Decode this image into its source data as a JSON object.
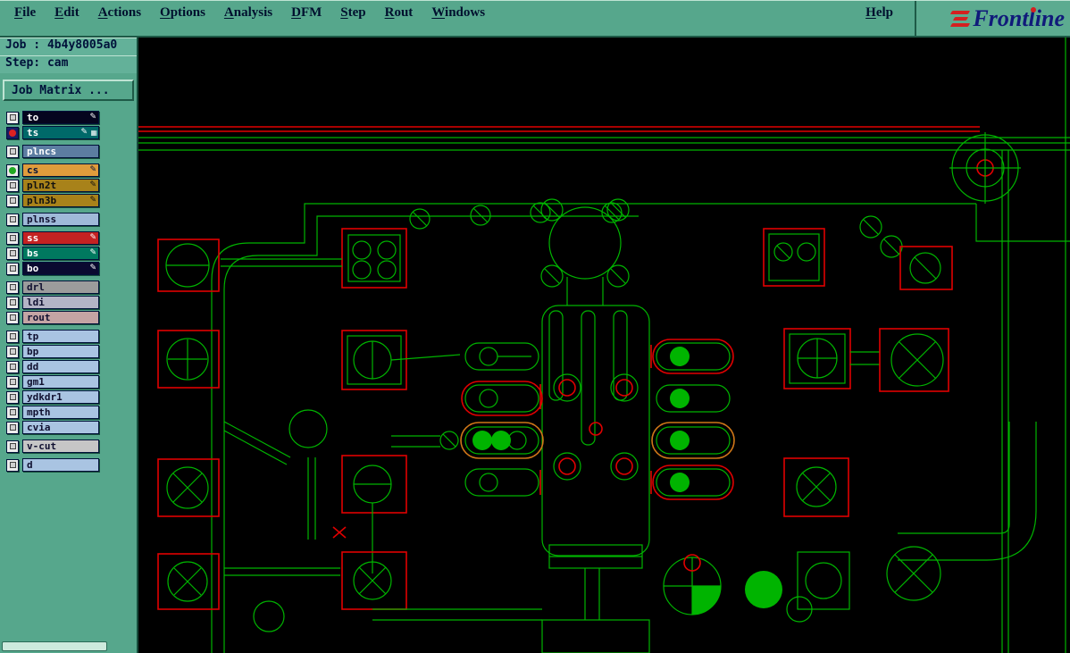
{
  "menu": {
    "items": [
      "File",
      "Edit",
      "Actions",
      "Options",
      "Analysis",
      "DFM",
      "Step",
      "Rout",
      "Windows"
    ],
    "help": "Help"
  },
  "brand": {
    "name": "Frontline"
  },
  "sidebar": {
    "job": "Job : 4b4y8005a0",
    "step": "Step: cam",
    "job_matrix": "Job Matrix ...",
    "layers": [
      {
        "name": "to",
        "bg": "#05051e",
        "fg": "#ffffff",
        "indicator": "square",
        "pen": true,
        "extra": false,
        "group": 0
      },
      {
        "name": "ts",
        "bg": "#006969",
        "fg": "#ffffff",
        "indicator": "red-dot",
        "pen": true,
        "extra": true,
        "group": 0
      },
      {
        "name": "plncs",
        "bg": "#5c7da1",
        "fg": "#ffffff",
        "indicator": "square",
        "pen": false,
        "extra": false,
        "group": 1
      },
      {
        "name": "cs",
        "bg": "#e09c3c",
        "fg": "#00113a",
        "indicator": "green-dot",
        "pen": true,
        "extra": false,
        "group": 2
      },
      {
        "name": "pln2t",
        "bg": "#a8821a",
        "fg": "#101010",
        "indicator": "square",
        "pen": true,
        "extra": false,
        "group": 2
      },
      {
        "name": "pln3b",
        "bg": "#a8821a",
        "fg": "#101010",
        "indicator": "square",
        "pen": true,
        "extra": false,
        "group": 2
      },
      {
        "name": "plnss",
        "bg": "#9fb9d8",
        "fg": "#101030",
        "indicator": "square",
        "pen": false,
        "extra": false,
        "group": 3
      },
      {
        "name": "ss",
        "bg": "#c42222",
        "fg": "#ffffff",
        "indicator": "square",
        "pen": true,
        "extra": false,
        "group": 4
      },
      {
        "name": "bs",
        "bg": "#00795f",
        "fg": "#ffffff",
        "indicator": "square",
        "pen": true,
        "extra": false,
        "group": 4
      },
      {
        "name": "bo",
        "bg": "#0a0a30",
        "fg": "#ffffff",
        "indicator": "square",
        "pen": true,
        "extra": false,
        "group": 4
      },
      {
        "name": "drl",
        "bg": "#9c9c9c",
        "fg": "#101030",
        "indicator": "square",
        "pen": false,
        "extra": false,
        "group": 5
      },
      {
        "name": "ldi",
        "bg": "#b4b4c6",
        "fg": "#101030",
        "indicator": "square",
        "pen": false,
        "extra": false,
        "group": 5
      },
      {
        "name": "rout",
        "bg": "#c4a4a4",
        "fg": "#101030",
        "indicator": "square",
        "pen": false,
        "extra": false,
        "group": 5
      },
      {
        "name": "tp",
        "bg": "#a9c4e2",
        "fg": "#101030",
        "indicator": "square",
        "pen": false,
        "extra": false,
        "group": 6
      },
      {
        "name": "bp",
        "bg": "#a9c4e2",
        "fg": "#101030",
        "indicator": "square",
        "pen": false,
        "extra": false,
        "group": 6
      },
      {
        "name": "dd",
        "bg": "#a9c4e2",
        "fg": "#101030",
        "indicator": "square",
        "pen": false,
        "extra": false,
        "group": 6
      },
      {
        "name": "gm1",
        "bg": "#a9c4e2",
        "fg": "#101030",
        "indicator": "square",
        "pen": false,
        "extra": false,
        "group": 6
      },
      {
        "name": "ydkdr1",
        "bg": "#a9c4e2",
        "fg": "#101030",
        "indicator": "square",
        "pen": false,
        "extra": false,
        "group": 6
      },
      {
        "name": "mpth",
        "bg": "#a9c4e2",
        "fg": "#101030",
        "indicator": "square",
        "pen": false,
        "extra": false,
        "group": 6
      },
      {
        "name": "cvia",
        "bg": "#a9c4e2",
        "fg": "#101030",
        "indicator": "square",
        "pen": false,
        "extra": false,
        "group": 6
      },
      {
        "name": "v-cut",
        "bg": "#c6c6c6",
        "fg": "#101030",
        "indicator": "square",
        "pen": false,
        "extra": false,
        "group": 7
      },
      {
        "name": "d",
        "bg": "#a9c4e2",
        "fg": "#101030",
        "indicator": "square",
        "pen": false,
        "extra": false,
        "group": 8
      }
    ]
  },
  "icons": {
    "pen_icon": "✎",
    "grid_icon": "▦"
  },
  "colors": {
    "ui_teal": "#56a78c",
    "ui_teal_light": "#bfe4d4",
    "ui_teal_dark": "#1e5a47",
    "text_navy": "#00113a",
    "brand_navy": "#101a7a",
    "brand_red": "#d42020",
    "canvas_background": "#000000",
    "trace_green": "#00b400",
    "pad_red": "#e00000",
    "highlight_orange": "#d07818",
    "indicator_red": "#dd2222",
    "indicator_green": "#22aa22"
  }
}
